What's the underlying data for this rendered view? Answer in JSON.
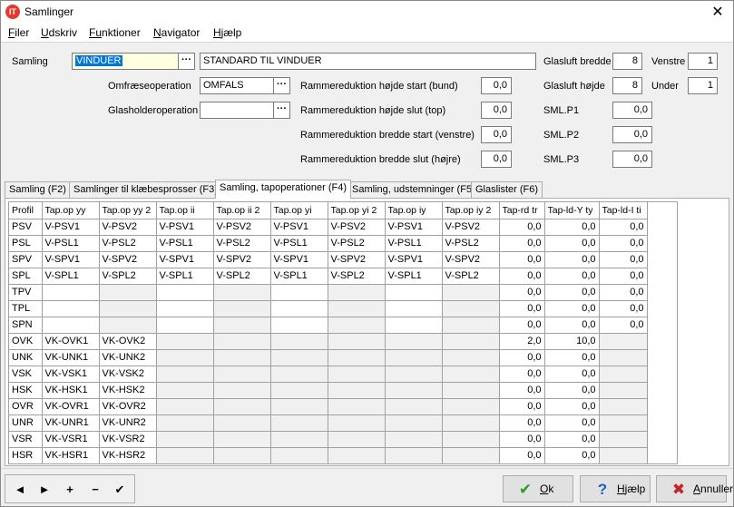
{
  "window": {
    "title": "Samlinger",
    "close": "✕",
    "app_icon": "IT"
  },
  "menu": [
    {
      "key": "F",
      "rest": "iler"
    },
    {
      "key": "U",
      "rest": "dskriv"
    },
    {
      "key": "Fu",
      "rest": "nktioner"
    },
    {
      "key": "N",
      "rest": "avigator"
    },
    {
      "key": "H",
      "rest": "jælp"
    }
  ],
  "form": {
    "samling_label": "Samling",
    "samling_value": "VINDUER",
    "samling_desc": "STANDARD TIL VINDUER",
    "omfraese_label": "Omfræseoperation",
    "omfraese_value": "OMFALS",
    "glasholder_label": "Glasholderoperation",
    "glasholder_value": "",
    "rr_hoejde_start_label": "Rammereduktion højde start (bund)",
    "rr_hoejde_start_value": "0,0",
    "rr_hoejde_slut_label": "Rammereduktion højde slut (top)",
    "rr_hoejde_slut_value": "0,0",
    "rr_bredde_start_label": "Rammereduktion bredde start (venstre)",
    "rr_bredde_start_value": "0,0",
    "rr_bredde_slut_label": "Rammereduktion bredde slut (højre)",
    "rr_bredde_slut_value": "0,0",
    "glasluft_bredde_label": "Glasluft bredde",
    "glasluft_bredde_value": "8",
    "glasluft_hoejde_label": "Glasluft højde",
    "glasluft_hoejde_value": "8",
    "venstre_label": "Venstre",
    "venstre_value": "1",
    "under_label": "Under",
    "under_value": "1",
    "smlp1_label": "SML.P1",
    "smlp1_value": "0,0",
    "smlp2_label": "SML.P2",
    "smlp2_value": "0,0",
    "smlp3_label": "SML.P3",
    "smlp3_value": "0,0",
    "dots": "···"
  },
  "tabs": [
    {
      "label": "Samling (F2)",
      "active": false
    },
    {
      "label": "Samlinger til klæbesprosser (F3)",
      "active": false
    },
    {
      "label": "Samling, tapoperationer (F4)",
      "active": true
    },
    {
      "label": "Samling, udstemninger (F5)",
      "active": false
    },
    {
      "label": "Glaslister (F6)",
      "active": false
    }
  ],
  "grid": {
    "columns": [
      "Profil",
      "Tap.op yy",
      "Tap.op yy 2",
      "Tap.op ii",
      "Tap.op ii 2",
      "Tap.op yi",
      "Tap.op yi 2",
      "Tap.op iy",
      "Tap.op iy 2",
      "Tap-rd tr",
      "Tap-ld-Y ty",
      "Tap-ld-I ti"
    ],
    "rows": [
      [
        "PSV",
        "V-PSV1",
        "V-PSV2",
        "V-PSV1",
        "V-PSV2",
        "V-PSV1",
        "V-PSV2",
        "V-PSV1",
        "V-PSV2",
        "0,0",
        "0,0",
        "0,0"
      ],
      [
        "PSL",
        "V-PSL1",
        "V-PSL2",
        "V-PSL1",
        "V-PSL2",
        "V-PSL1",
        "V-PSL2",
        "V-PSL1",
        "V-PSL2",
        "0,0",
        "0,0",
        "0,0"
      ],
      [
        "SPV",
        "V-SPV1",
        "V-SPV2",
        "V-SPV1",
        "V-SPV2",
        "V-SPV1",
        "V-SPV2",
        "V-SPV1",
        "V-SPV2",
        "0,0",
        "0,0",
        "0,0"
      ],
      [
        "SPL",
        "V-SPL1",
        "V-SPL2",
        "V-SPL1",
        "V-SPL2",
        "V-SPL1",
        "V-SPL2",
        "V-SPL1",
        "V-SPL2",
        "0,0",
        "0,0",
        "0,0"
      ],
      [
        "TPV",
        "",
        "",
        "",
        "",
        "",
        "",
        "",
        "",
        "0,0",
        "0,0",
        "0,0"
      ],
      [
        "TPL",
        "",
        "",
        "",
        "",
        "",
        "",
        "",
        "",
        "0,0",
        "0,0",
        "0,0"
      ],
      [
        "SPN",
        "",
        "",
        "",
        "",
        "",
        "",
        "",
        "",
        "0,0",
        "0,0",
        "0,0"
      ],
      [
        "OVK",
        "VK-OVK1",
        "VK-OVK2",
        "",
        "",
        "",
        "",
        "",
        "",
        "2,0",
        "10,0",
        ""
      ],
      [
        "UNK",
        "VK-UNK1",
        "VK-UNK2",
        "",
        "",
        "",
        "",
        "",
        "",
        "0,0",
        "0,0",
        ""
      ],
      [
        "VSK",
        "VK-VSK1",
        "VK-VSK2",
        "",
        "",
        "",
        "",
        "",
        "",
        "0,0",
        "0,0",
        ""
      ],
      [
        "HSK",
        "VK-HSK1",
        "VK-HSK2",
        "",
        "",
        "",
        "",
        "",
        "",
        "0,0",
        "0,0",
        ""
      ],
      [
        "OVR",
        "VK-OVR1",
        "VK-OVR2",
        "",
        "",
        "",
        "",
        "",
        "",
        "0,0",
        "0,0",
        ""
      ],
      [
        "UNR",
        "VK-UNR1",
        "VK-UNR2",
        "",
        "",
        "",
        "",
        "",
        "",
        "0,0",
        "0,0",
        ""
      ],
      [
        "VSR",
        "VK-VSR1",
        "VK-VSR2",
        "",
        "",
        "",
        "",
        "",
        "",
        "0,0",
        "0,0",
        ""
      ],
      [
        "HSR",
        "VK-HSR1",
        "VK-HSR2",
        "",
        "",
        "",
        "",
        "",
        "",
        "0,0",
        "0,0",
        ""
      ]
    ]
  },
  "nav": {
    "first": "◄",
    "next": "►",
    "add": "+",
    "remove": "−",
    "confirm": "✔"
  },
  "buttons": {
    "ok_key": "O",
    "ok_rest": "k",
    "help_key": "H",
    "help_rest": "jælp",
    "cancel_key": "A",
    "cancel_rest": "nnuller",
    "ok_icon": "check-icon",
    "help_icon": "question-icon",
    "cancel_icon": "x-icon"
  }
}
